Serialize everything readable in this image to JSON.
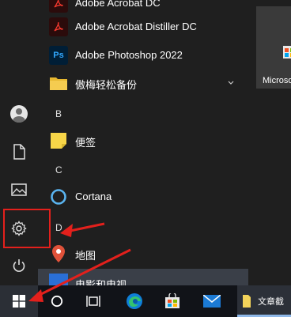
{
  "list": {
    "items": [
      {
        "label": "Adobe Acrobat DC",
        "icon": "acrobat-icon"
      },
      {
        "label": "Adobe Acrobat Distiller DC",
        "icon": "acrobat-distiller-icon"
      },
      {
        "label": "Adobe Photoshop 2022",
        "icon": "photoshop-icon"
      },
      {
        "label": "傲梅轻松备份",
        "icon": "folder-icon"
      }
    ],
    "section_b": "B",
    "item_b": {
      "label": "便签",
      "icon": "sticky-notes-icon"
    },
    "section_c": "C",
    "item_c": {
      "label": "Cortana",
      "icon": "cortana-icon"
    },
    "section_d": "D",
    "item_d1": {
      "label": "地图",
      "icon": "maps-icon"
    },
    "item_d2": {
      "label": "电影和电视",
      "icon": "movies-tv-icon"
    }
  },
  "tiles": {
    "store_label": "Microso"
  },
  "taskbar": {
    "file_label": "文章截"
  },
  "colors": {
    "annotation_red": "#e3201c",
    "photoshop_blue": "#001e36",
    "acrobat_red": "#2b0b0b"
  }
}
